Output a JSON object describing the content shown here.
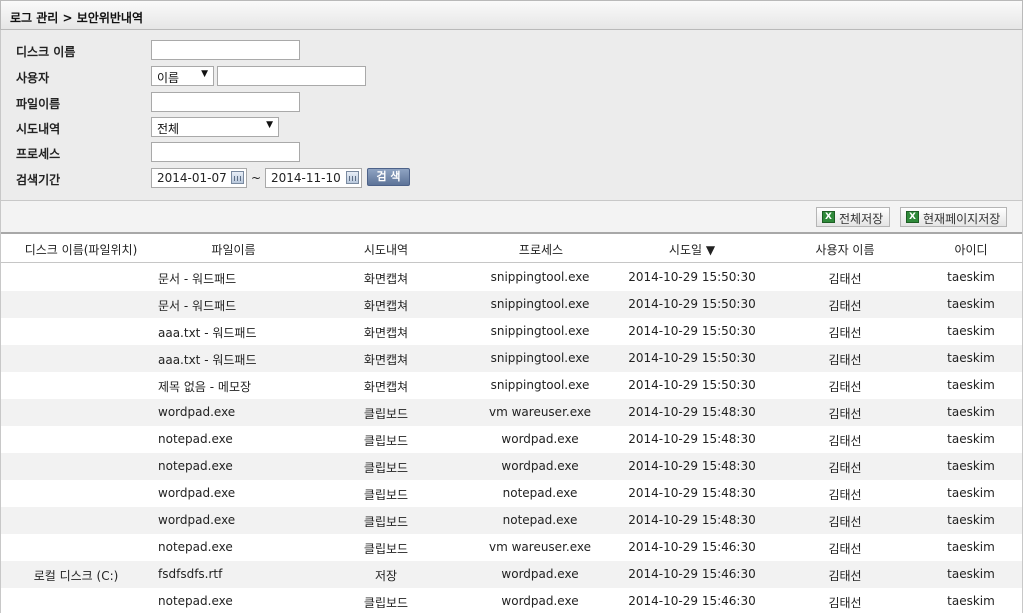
{
  "breadcrumb": "로그 관리 > 보안위반내역",
  "filters": {
    "disk_label": "디스크 이름",
    "disk_value": "",
    "user_label": "사용자",
    "user_select": "이름",
    "user_value": "",
    "file_label": "파일이름",
    "file_value": "",
    "attempt_label": "시도내역",
    "attempt_select": "전체",
    "process_label": "프로세스",
    "process_value": "",
    "period_label": "검색기간",
    "date_from": "2014-01-07",
    "date_sep": "~",
    "date_to": "2014-11-10",
    "search_label": "검 색"
  },
  "toolbar": {
    "export_all": "전체저장",
    "export_page": "현재페이지저장",
    "excel_icon_glyph": "X"
  },
  "table": {
    "columns": [
      "디스크 이름(파일위치)",
      "파일이름",
      "시도내역",
      "프로세스",
      "시도일 ▼",
      "사용자 이름",
      "아이디"
    ],
    "rows": [
      [
        "",
        "문서 - 워드패드",
        "화면캡쳐",
        "snippingtool.exe",
        "2014-10-29 15:50:30",
        "김태선",
        "taeskim"
      ],
      [
        "",
        "문서 - 워드패드",
        "화면캡쳐",
        "snippingtool.exe",
        "2014-10-29 15:50:30",
        "김태선",
        "taeskim"
      ],
      [
        "",
        "aaa.txt - 워드패드",
        "화면캡쳐",
        "snippingtool.exe",
        "2014-10-29 15:50:30",
        "김태선",
        "taeskim"
      ],
      [
        "",
        "aaa.txt - 워드패드",
        "화면캡쳐",
        "snippingtool.exe",
        "2014-10-29 15:50:30",
        "김태선",
        "taeskim"
      ],
      [
        "",
        "제목 없음 - 메모장",
        "화면캡쳐",
        "snippingtool.exe",
        "2014-10-29 15:50:30",
        "김태선",
        "taeskim"
      ],
      [
        "",
        "wordpad.exe",
        "클립보드",
        "vm wareuser.exe",
        "2014-10-29 15:48:30",
        "김태선",
        "taeskim"
      ],
      [
        "",
        "notepad.exe",
        "클립보드",
        "wordpad.exe",
        "2014-10-29 15:48:30",
        "김태선",
        "taeskim"
      ],
      [
        "",
        "notepad.exe",
        "클립보드",
        "wordpad.exe",
        "2014-10-29 15:48:30",
        "김태선",
        "taeskim"
      ],
      [
        "",
        "wordpad.exe",
        "클립보드",
        "notepad.exe",
        "2014-10-29 15:48:30",
        "김태선",
        "taeskim"
      ],
      [
        "",
        "wordpad.exe",
        "클립보드",
        "notepad.exe",
        "2014-10-29 15:48:30",
        "김태선",
        "taeskim"
      ],
      [
        "",
        "notepad.exe",
        "클립보드",
        "vm wareuser.exe",
        "2014-10-29 15:46:30",
        "김태선",
        "taeskim"
      ],
      [
        "로컬 디스크 (C:)",
        "fsdfsdfs.rtf",
        "저장",
        "wordpad.exe",
        "2014-10-29 15:46:30",
        "김태선",
        "taeskim"
      ],
      [
        "",
        "notepad.exe",
        "클립보드",
        "wordpad.exe",
        "2014-10-29 15:46:30",
        "김태선",
        "taeskim"
      ]
    ]
  }
}
